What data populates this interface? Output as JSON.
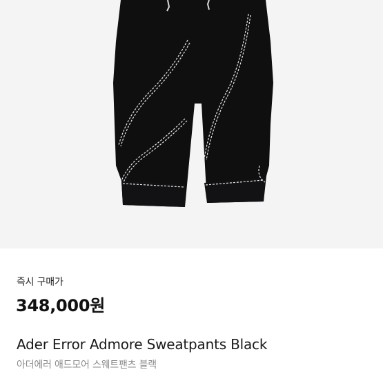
{
  "product": {
    "image_icon": "sweatpants-photo",
    "price_label": "즉시 구매가",
    "price": "348,000원",
    "title_en": "Ader Error Admore Sweatpants Black",
    "title_ko": "아더에러 애드모어 스웨트팬츠 블랙"
  },
  "colors": {
    "image_bg": "#f4f4f4",
    "pants": "#0f0f10",
    "stitch": "#e8e8e8"
  }
}
